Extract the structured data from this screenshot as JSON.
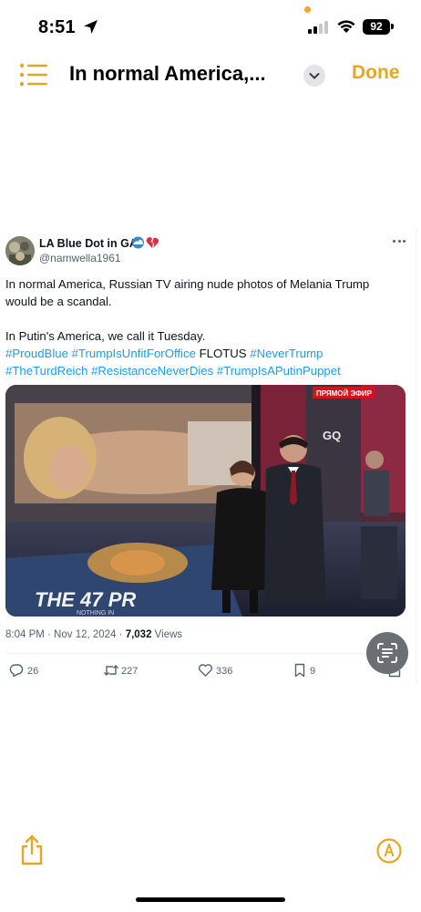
{
  "status_bar": {
    "time": "8:51",
    "battery": "92"
  },
  "nav": {
    "title": "In normal America,...",
    "done_label": "Done"
  },
  "tweet": {
    "display_name": "LA Blue Dot in GA",
    "handle": "@namwella1961",
    "text_line1": "In normal America, Russian TV airing nude photos of Melania Trump",
    "text_line2": "would be a scandal.",
    "text_line3": "In Putin's America, we call it Tuesday.",
    "hashtags_line1": [
      "#ProudBlue",
      "#TrumpIsUnfitForOffice"
    ],
    "plain_word": "FLOTUS",
    "hashtag_never_trump": "#NeverTrump",
    "hashtags_line2": [
      "#TheTurdReich",
      "#ResistanceNeverDies",
      "#TrumpIsAPutinPuppet"
    ],
    "media": {
      "live_badge": "ПРЯМОЙ ЭФИР",
      "gq_text": "GQ",
      "floor_text": "THE 47 PR",
      "floor_subtext": "NOTHING IN"
    },
    "timestamp": "8:04 PM · Nov 12, 2024 ·",
    "views_count": "7,032",
    "views_label": "Views",
    "replies": "26",
    "reposts": "227",
    "likes": "336",
    "bookmarks": "9"
  },
  "icons": {
    "location": "location-arrow-icon",
    "list": "list-icon",
    "chevron": "chevron-down-icon",
    "live_text": "live-text-icon",
    "share": "share-icon",
    "markup": "markup-icon"
  },
  "colors": {
    "accent": "#e6a623",
    "link": "#1d9bf0",
    "muted": "#536471"
  }
}
